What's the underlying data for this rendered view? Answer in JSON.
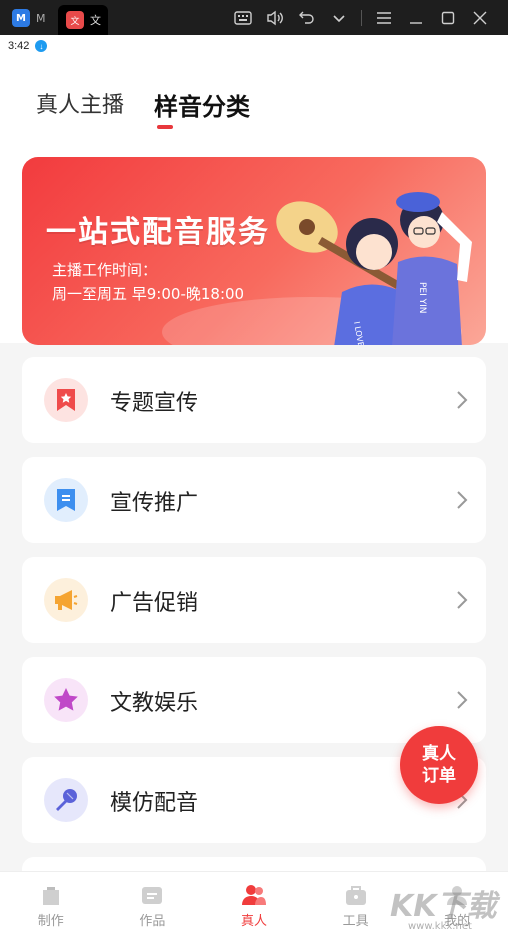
{
  "window": {
    "inactive_tab_label": "M",
    "active_tab_label": "文",
    "active_tab_icon": "文",
    "app_icon_letter": "M"
  },
  "status": {
    "time": "3:42"
  },
  "tabs": [
    {
      "label": "真人主播",
      "active": false
    },
    {
      "label": "样音分类",
      "active": true
    }
  ],
  "banner": {
    "title": "一站式配音服务",
    "hours_label": "主播工作时间：",
    "hours": "周一至周五 早9:00-晚18:00",
    "shirt_text_left": "I LOVE PEI YIN",
    "shirt_text_right": "PEI YIN"
  },
  "categories": [
    {
      "label": "专题宣传",
      "icon": "bookmark-star-icon",
      "bg": "#fde3e1",
      "color": "#ef4b4b"
    },
    {
      "label": "宣传推广",
      "icon": "document-icon",
      "bg": "#e1eefd",
      "color": "#3d8fef"
    },
    {
      "label": "广告促销",
      "icon": "megaphone-icon",
      "bg": "#fdf0dc",
      "color": "#f5a431"
    },
    {
      "label": "文教娱乐",
      "icon": "star-icon",
      "bg": "#f8e4f8",
      "color": "#c048c8"
    },
    {
      "label": "模仿配音",
      "icon": "microphone-icon",
      "bg": "#e6e7fb",
      "color": "#5b62d9"
    }
  ],
  "fab": {
    "line1": "真人",
    "line2": "订单"
  },
  "nav": [
    {
      "label": "制作",
      "icon": "make-icon",
      "active": false
    },
    {
      "label": "作品",
      "icon": "works-icon",
      "active": false
    },
    {
      "label": "真人",
      "icon": "person-icon",
      "active": true
    },
    {
      "label": "工具",
      "icon": "toolbox-icon",
      "active": false
    },
    {
      "label": "我的",
      "icon": "profile-icon",
      "active": false
    }
  ],
  "watermark": {
    "text": "KK下载",
    "url": "www.kkx.net"
  },
  "colors": {
    "accent": "#f03c3c",
    "inactive": "#999999"
  }
}
